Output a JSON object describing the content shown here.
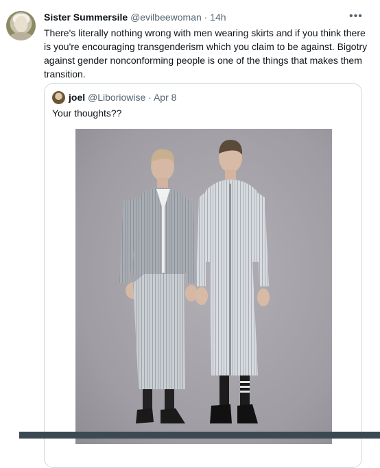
{
  "tweet": {
    "author_name": "Sister Summersile",
    "author_handle": "@evilbeewoman",
    "separator": "·",
    "time": "14h",
    "more_icon": "more-horizontal-icon",
    "text": "There's literally nothing wrong with men wearing skirts and if you think there is you're encouraging transgenderism which you claim to be against. Bigotry against gender nonconforming people is one of the things that makes them transition."
  },
  "quote": {
    "author_name": "joel",
    "author_handle": "@Liboriowise",
    "separator": "·",
    "date": "Apr 8",
    "text": "Your thoughts??"
  },
  "colors": {
    "text_primary": "#0f1419",
    "text_secondary": "#536471",
    "border": "#cfd9de",
    "photo_background": "#9f9da3"
  }
}
